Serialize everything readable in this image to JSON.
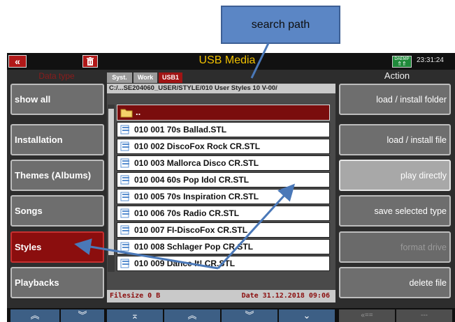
{
  "annotation": {
    "label": "search path"
  },
  "titlebar": {
    "back_icon": "«",
    "title": "USB Media",
    "sd_label": "DAEMP",
    "time": "23:31:24"
  },
  "left": {
    "header": "Data type",
    "items": [
      {
        "label": "show all",
        "active": false
      },
      {
        "label": "Installation",
        "active": false
      },
      {
        "label": "Themes (Albums)",
        "active": false
      },
      {
        "label": "Songs",
        "active": false
      },
      {
        "label": "Styles",
        "active": true
      },
      {
        "label": "Playbacks",
        "active": false
      }
    ]
  },
  "center": {
    "tabs": [
      "Syst.",
      "Work",
      "USB1"
    ],
    "path": "C:/...SE204060_USER/STYLE/010 User Styles 10 V-00/",
    "folder_up": "..",
    "files": [
      "010 001 70s Ballad.STL",
      "010 002 DiscoFox Rock CR.STL",
      "010 003 Mallorca Disco CR.STL",
      "010 004 60s Pop Idol CR.STL",
      "010 005 70s Inspiration CR.STL",
      "010 006 70s Radio CR.STL",
      "010 007 FI-DiscoFox CR.STL",
      "010 008 Schlager Pop CR.STL",
      "010 009 Dance It! CR.STL"
    ],
    "filesize": "Filesize 0 B",
    "date": "Date 31.12.2018  09:06"
  },
  "right": {
    "header": "Action",
    "items": [
      {
        "label": "load  /  install folder",
        "state": "normal"
      },
      {
        "label": "load  /  install file",
        "state": "normal"
      },
      {
        "label": "play directly",
        "state": "selected"
      },
      {
        "label": "save selected type",
        "state": "normal"
      },
      {
        "label": "format drive",
        "state": "disabled"
      },
      {
        "label": "delete file",
        "state": "normal"
      }
    ]
  },
  "bottom": {
    "buttons": [
      "«",
      "»",
      "↑",
      "«",
      "»",
      "↓",
      "«==",
      "---"
    ]
  },
  "colors": {
    "accent_red": "#8b0e0e",
    "title_yellow": "#f0c000",
    "callout_blue": "#5b86c5",
    "arrow_blue": "#4a78b8"
  }
}
